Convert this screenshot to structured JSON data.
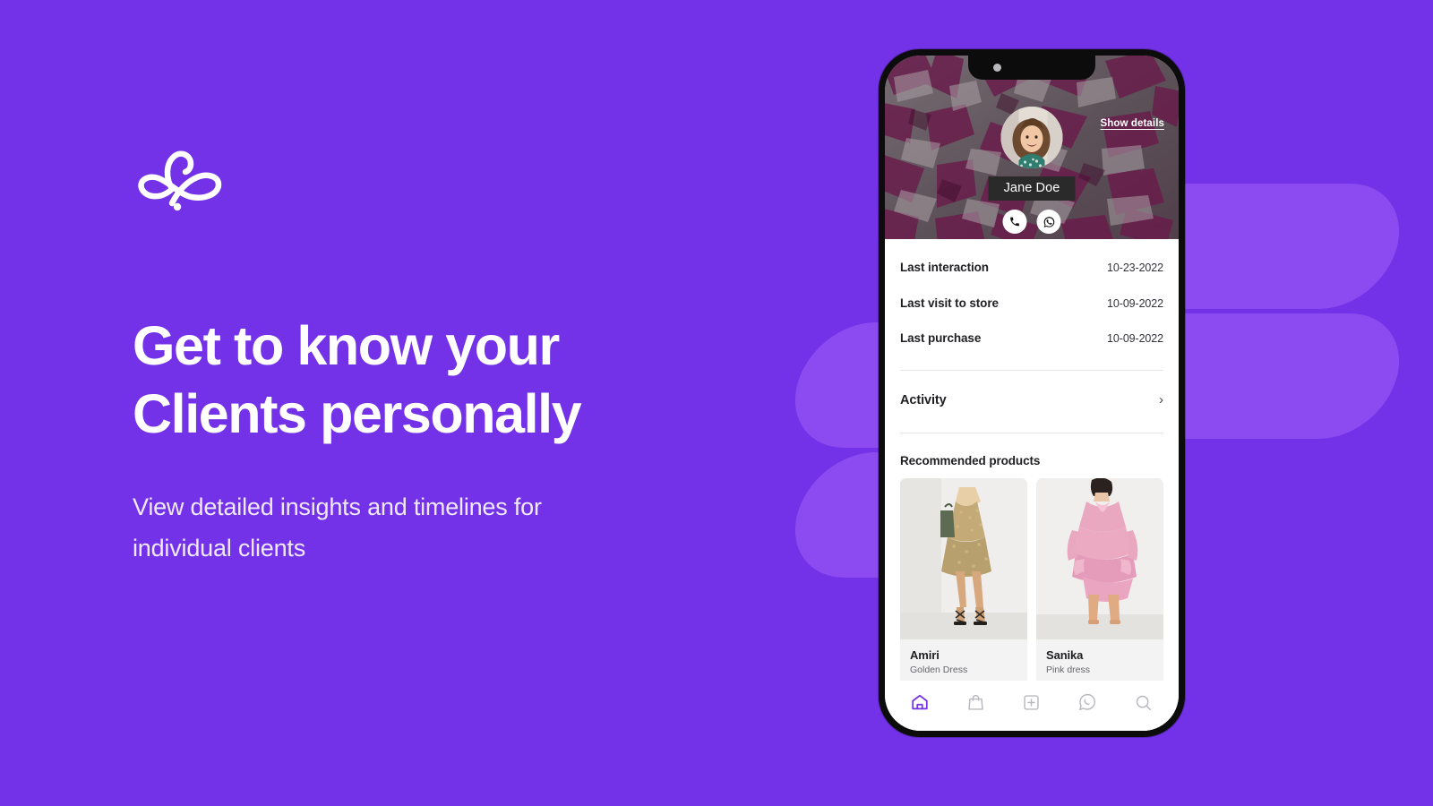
{
  "theme": {
    "background": "#7331e8",
    "decor_shape": "#8b4bf0",
    "accent": "#7331e8",
    "phone_frame": "#0c0c0c",
    "chip_background": "#2a2a2a"
  },
  "marketing": {
    "logo_name": "brand-flourish-logo",
    "headline_line1": "Get to know your",
    "headline_line2": "Clients personally",
    "subhead_line1": "View detailed insights and timelines for",
    "subhead_line2": "individual clients"
  },
  "phone": {
    "hero": {
      "show_details_label": "Show details",
      "client_name": "Jane Doe",
      "avatar_alt": "client-avatar",
      "actions": [
        {
          "icon": "phone-icon",
          "name": "call-button"
        },
        {
          "icon": "whatsapp-icon",
          "name": "whatsapp-button"
        }
      ]
    },
    "details": [
      {
        "label": "Last interaction",
        "value": "10-23-2022"
      },
      {
        "label": "Last visit to store",
        "value": "10-09-2022"
      },
      {
        "label": "Last purchase",
        "value": "10-09-2022"
      }
    ],
    "activity": {
      "label": "Activity",
      "chevron": "›"
    },
    "recommended": {
      "title": "Recommended products",
      "products": [
        {
          "name": "Amiri",
          "subtitle": "Golden Dress"
        },
        {
          "name": "Sanika",
          "subtitle": "Pink dress"
        }
      ]
    },
    "tabbar": [
      {
        "icon": "home-icon",
        "name": "tab-home",
        "active": true
      },
      {
        "icon": "shopping-bag-icon",
        "name": "tab-shop",
        "active": false
      },
      {
        "icon": "plus-square-icon",
        "name": "tab-add",
        "active": false
      },
      {
        "icon": "whatsapp-icon",
        "name": "tab-whatsapp",
        "active": false
      },
      {
        "icon": "search-icon",
        "name": "tab-search",
        "active": false
      }
    ]
  }
}
